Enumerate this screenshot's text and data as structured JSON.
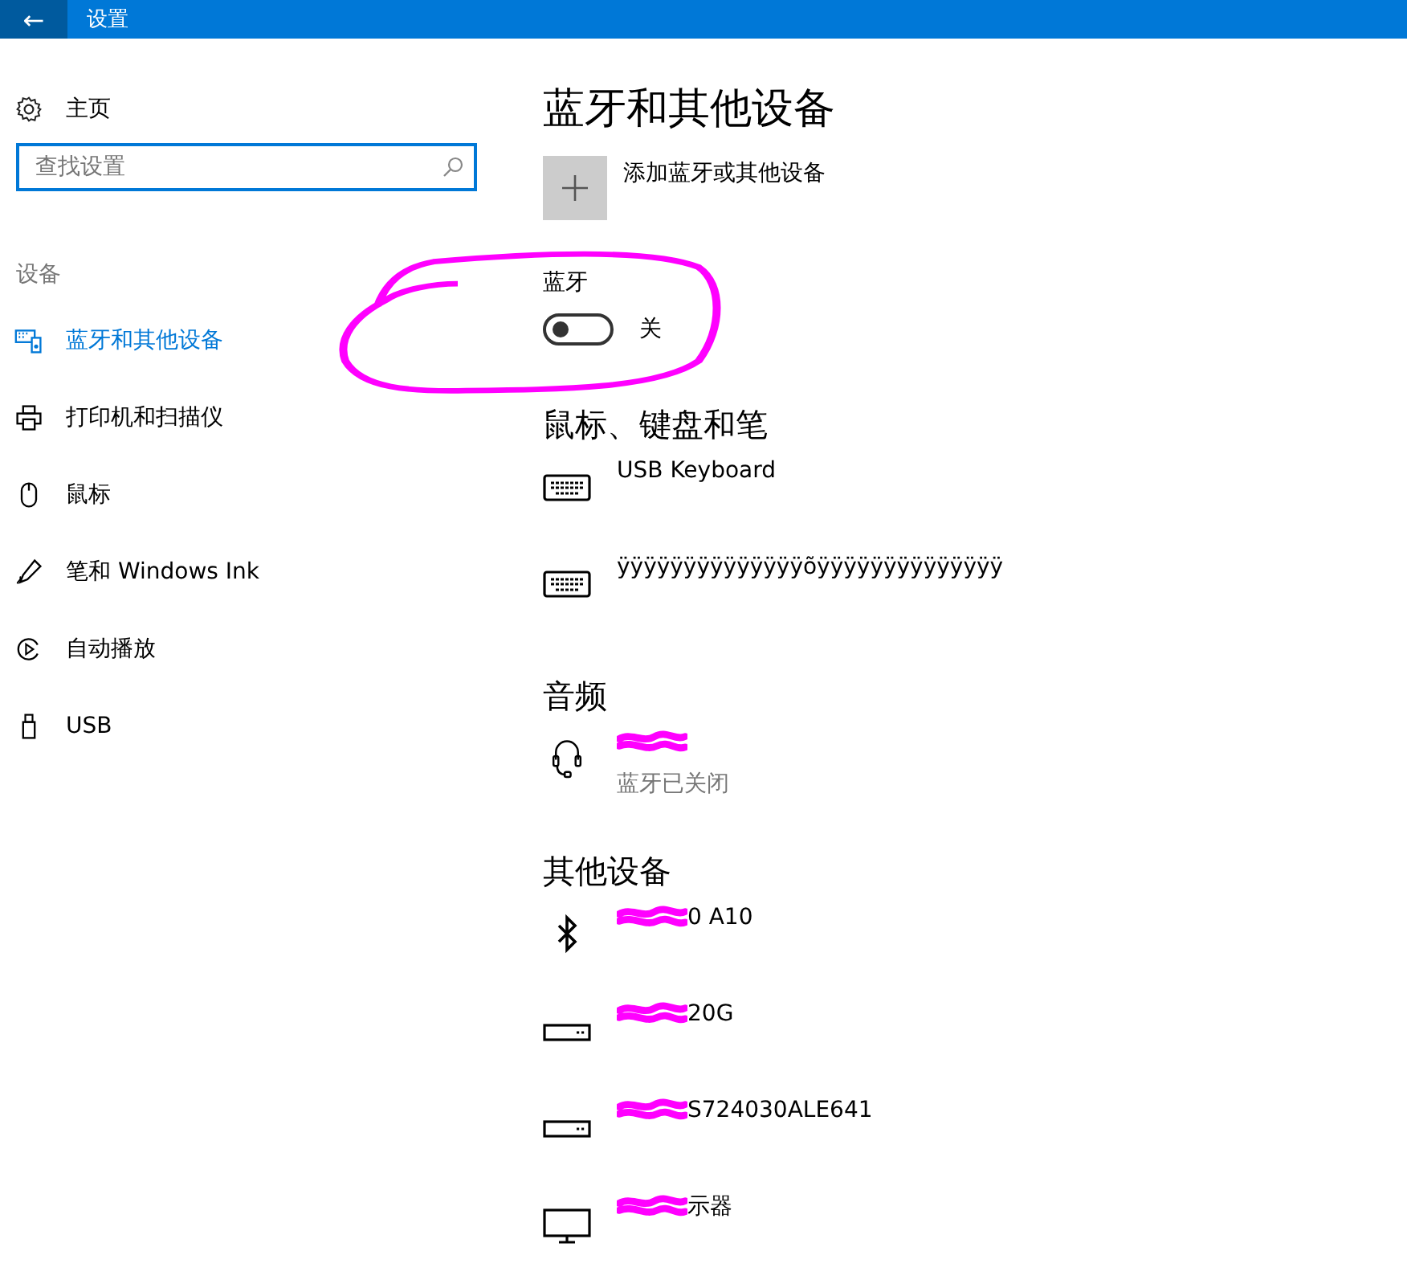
{
  "title_bar": {
    "back": "←",
    "title": "设置"
  },
  "sidebar": {
    "home": "主页",
    "search": {
      "placeholder": "查找设置"
    },
    "section": "设备",
    "items": [
      {
        "label": "蓝牙和其他设备",
        "kind": "devices",
        "selected": true
      },
      {
        "label": "打印机和扫描仪",
        "kind": "printer",
        "selected": false
      },
      {
        "label": "鼠标",
        "kind": "mouse",
        "selected": false
      },
      {
        "label": "笔和 Windows Ink",
        "kind": "pen",
        "selected": false
      },
      {
        "label": "自动播放",
        "kind": "autoplay",
        "selected": false
      },
      {
        "label": "USB",
        "kind": "usb",
        "selected": false
      }
    ]
  },
  "main": {
    "title": "蓝牙和其他设备",
    "add_button": "添加蓝牙或其他设备",
    "bluetooth": {
      "label": "蓝牙",
      "on": false,
      "state": "关"
    },
    "sections": [
      {
        "heading": "鼠标、键盘和笔",
        "devices": [
          {
            "kind": "keyboard",
            "redacted": false,
            "name": "USB Keyboard"
          },
          {
            "kind": "keyboard",
            "redacted": false,
            "name": "ÿÿÿÿÿÿÿÿÿÿÿÿÿÿõÿÿÿÿÿÿÿÿÿÿÿÿÿÿ"
          }
        ]
      },
      {
        "heading": "音频",
        "devices": [
          {
            "kind": "headset",
            "redacted": true,
            "status": "蓝牙已关闭"
          }
        ]
      },
      {
        "heading": "其他设备",
        "devices": [
          {
            "kind": "bluetooth",
            "redacted": true,
            "name": "0 A10"
          },
          {
            "kind": "drive",
            "redacted": true,
            "name": "20G"
          },
          {
            "kind": "drive",
            "redacted": true,
            "name": "S724030ALE641"
          },
          {
            "kind": "monitor",
            "redacted": true,
            "name": "示器"
          }
        ]
      }
    ]
  }
}
